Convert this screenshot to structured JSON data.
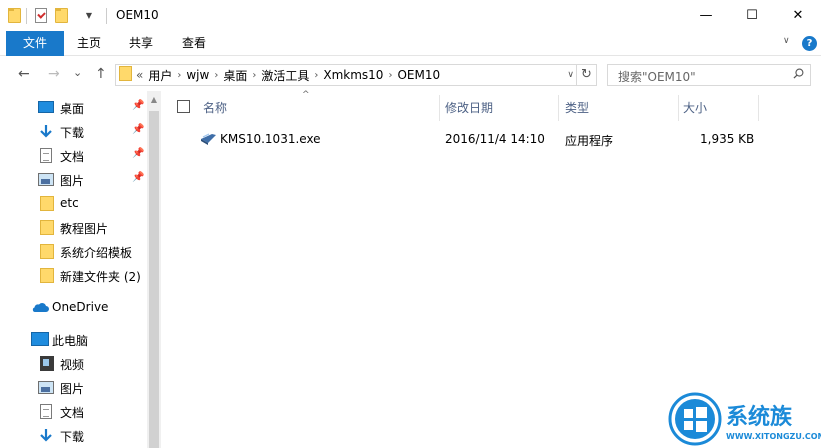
{
  "window": {
    "title": "OEM10",
    "minimize_glyph": "—",
    "maximize_glyph": "☐",
    "close_glyph": "✕"
  },
  "ribbon": {
    "tabs": [
      "文件",
      "主页",
      "共享",
      "查看"
    ]
  },
  "navigation": {
    "back_glyph": "←",
    "forward_glyph": "→",
    "dropdown_glyph": "⌄",
    "up_glyph": "↑",
    "address_overflow": "«",
    "breadcrumbs": [
      "用户",
      "wjw",
      "桌面",
      "激活工具",
      "Xmkms10",
      "OEM10"
    ],
    "refresh_glyph": "↻",
    "search_placeholder": "搜索\"OEM10\""
  },
  "sidebar": {
    "quick_access": [
      {
        "label": "桌面",
        "icon": "desktop-icon",
        "pinned": true
      },
      {
        "label": "下载",
        "icon": "download-icon",
        "pinned": true
      },
      {
        "label": "文档",
        "icon": "document-icon",
        "pinned": true
      },
      {
        "label": "图片",
        "icon": "pictures-icon",
        "pinned": true
      },
      {
        "label": "etc",
        "icon": "folder-icon",
        "pinned": false
      },
      {
        "label": "教程图片",
        "icon": "folder-icon",
        "pinned": false
      },
      {
        "label": "系统介绍模板",
        "icon": "folder-icon",
        "pinned": false
      },
      {
        "label": "新建文件夹 (2)",
        "icon": "folder-icon",
        "pinned": false
      }
    ],
    "onedrive": {
      "label": "OneDrive",
      "icon": "cloud-icon"
    },
    "this_pc": {
      "label": "此电脑",
      "icon": "computer-icon"
    },
    "this_pc_items": [
      {
        "label": "视频",
        "icon": "video-icon"
      },
      {
        "label": "图片",
        "icon": "pictures-icon"
      },
      {
        "label": "文档",
        "icon": "document-icon"
      },
      {
        "label": "下载",
        "icon": "download-icon"
      }
    ]
  },
  "file_list": {
    "columns": {
      "name": "名称",
      "modified": "修改日期",
      "type": "类型",
      "size": "大小"
    },
    "rows": [
      {
        "name": "KMS10.1031.exe",
        "modified": "2016/11/4 14:10",
        "type": "应用程序",
        "size": "1,935 KB",
        "icon": "exe-icon"
      }
    ]
  },
  "watermark": {
    "brand": "系统族",
    "url": "WWW.XITONGZU.COM"
  },
  "colors": {
    "accent": "#1979ca",
    "folder": "#ffd96b",
    "header_text": "#4d6185"
  }
}
